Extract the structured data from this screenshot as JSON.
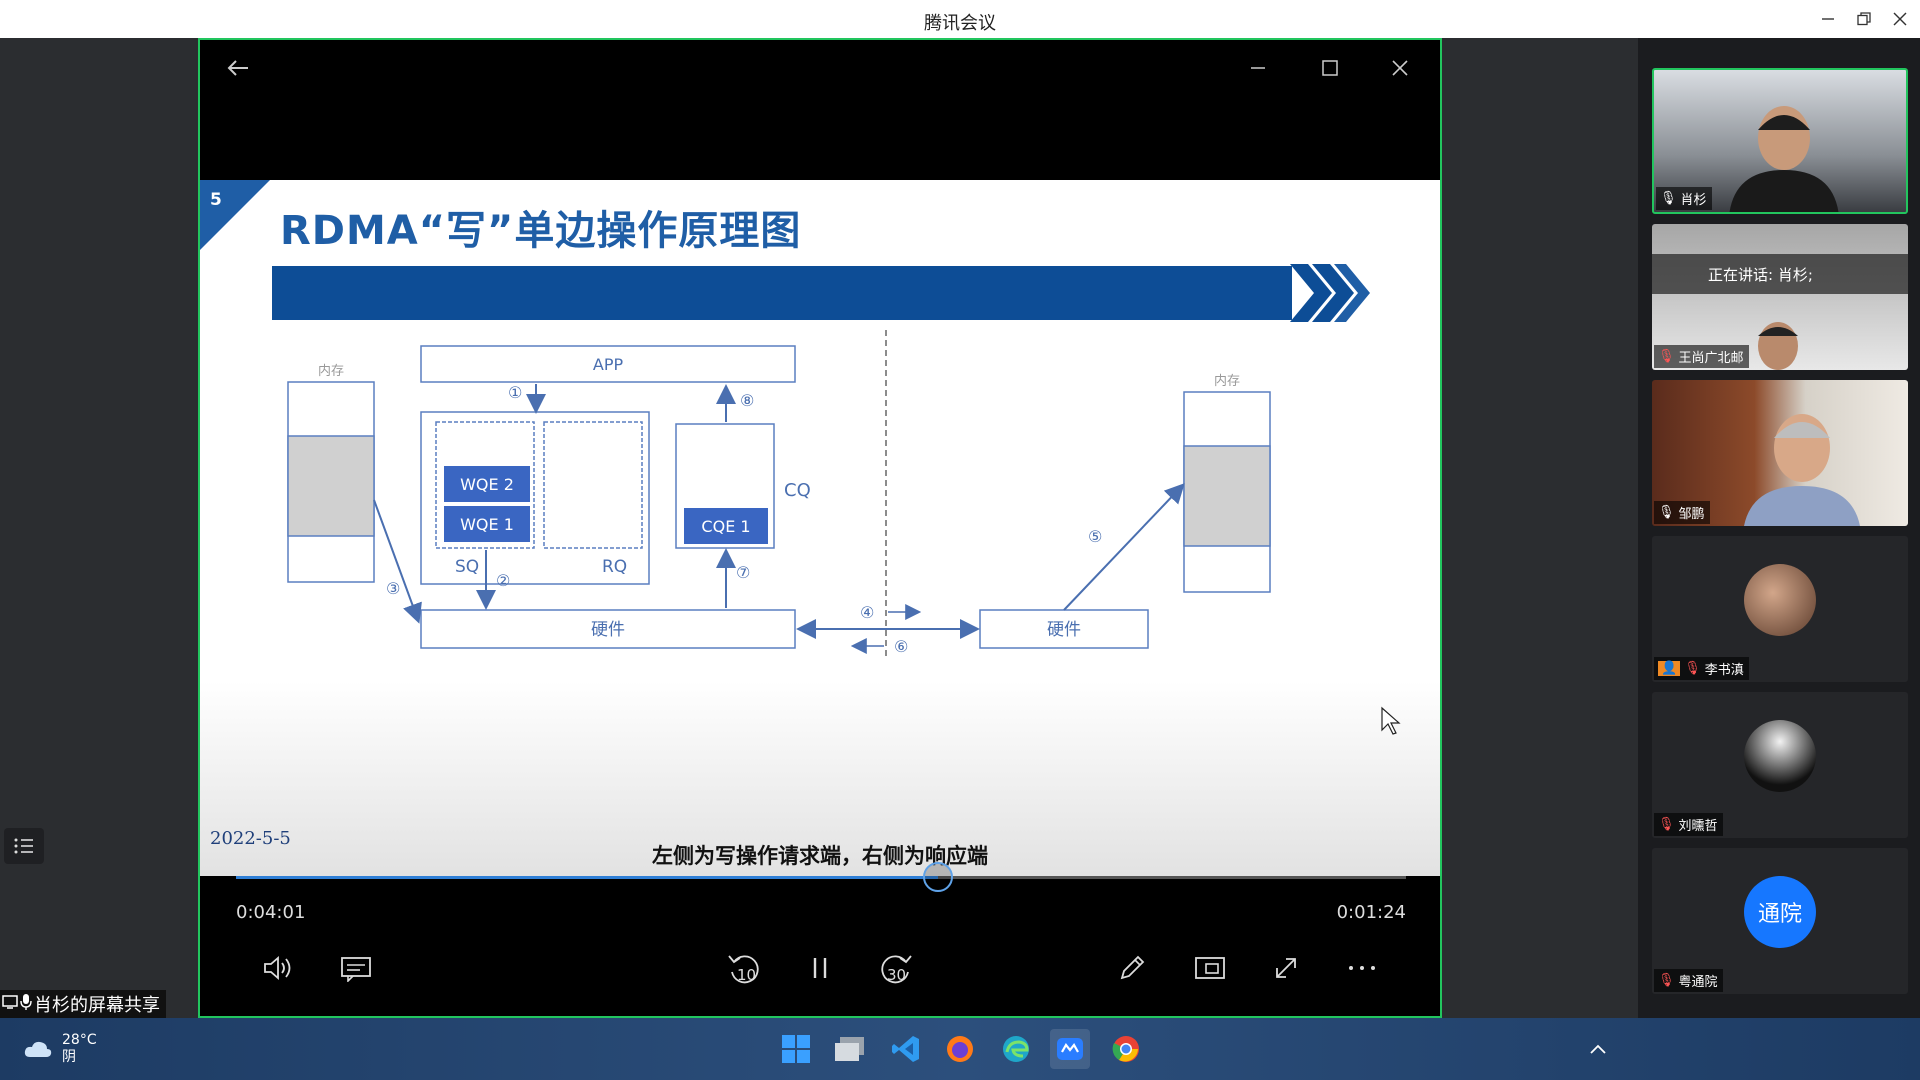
{
  "window": {
    "title": "腾讯会议"
  },
  "slide": {
    "number": "5",
    "title": "RDMA“写”单边操作原理图",
    "date": "2022-5-5",
    "diagram": {
      "mem_left": "内存",
      "mem_right": "内存",
      "app": "APP",
      "wqe2": "WQE 2",
      "wqe1": "WQE 1",
      "sq": "SQ",
      "rq": "RQ",
      "cq": "CQ",
      "cqe1": "CQE 1",
      "hw_left": "硬件",
      "hw_right": "硬件",
      "step1": "①",
      "step2": "②",
      "step3": "③",
      "step4": "④",
      "step5": "⑤",
      "step6": "⑥",
      "step7": "⑦",
      "step8": "⑧"
    }
  },
  "subtitle": "左侧为写操作请求端，右侧为响应端",
  "player": {
    "elapsed": "0:04:01",
    "remaining": "0:01:24",
    "progress_fraction": 0.6
  },
  "share": {
    "label": "肖杉的屏幕共享"
  },
  "participants": [
    {
      "name": "肖杉",
      "type": "video",
      "active": true
    },
    {
      "name": "王尚广北邮",
      "type": "video",
      "speaking_banner": "正在讲话: 肖杉;"
    },
    {
      "name": "邹鹏",
      "type": "video"
    },
    {
      "name": "李书滇",
      "type": "avatar"
    },
    {
      "name": "刘曛哲",
      "type": "avatar"
    },
    {
      "name": "粤通院",
      "type": "initials",
      "initials": "通院",
      "color": "#1677ff"
    }
  ],
  "taskbar": {
    "temperature": "28°C",
    "condition": "阴",
    "apps": [
      "windows-start",
      "file-explorer",
      "vscode",
      "firefox",
      "edge",
      "tencent-meeting",
      "chrome"
    ]
  }
}
